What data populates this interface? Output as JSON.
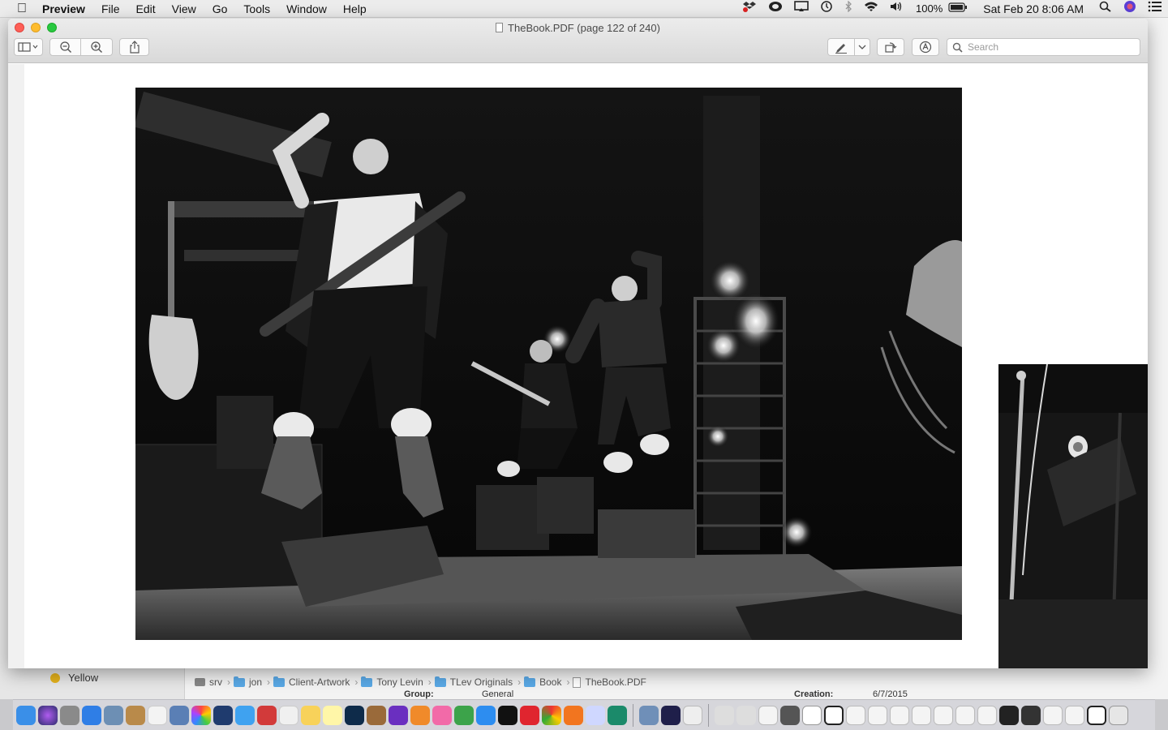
{
  "menubar": {
    "app_name": "Preview",
    "menus": [
      "File",
      "Edit",
      "View",
      "Go",
      "Tools",
      "Window",
      "Help"
    ],
    "battery": "100%",
    "clock": "Sat Feb 20  8:06 AM"
  },
  "window": {
    "title": "TheBook.PDF (page 122 of 240)",
    "search_placeholder": "Search",
    "toolbar_icons": [
      "sidebar-icon",
      "zoom-out-icon",
      "zoom-in-icon",
      "share-icon",
      "markup-pen-icon",
      "rotate-icon",
      "annotate-icon"
    ]
  },
  "background_finder": {
    "tag_label": "Yellow",
    "path": [
      "srv",
      "jon",
      "Client-Artwork",
      "Tony Levin",
      "TLev Originals",
      "Book",
      "TheBook.PDF"
    ],
    "meta": {
      "group_label": "Group:",
      "group_value": "General",
      "created_label": "Creation:",
      "created_value": "6/7/2015"
    }
  },
  "colors": {
    "accent": "#0a84ff",
    "close": "#fe5f57",
    "minimize": "#febc2e",
    "maximize": "#28c840",
    "tag_yellow": "#e4b21c"
  }
}
